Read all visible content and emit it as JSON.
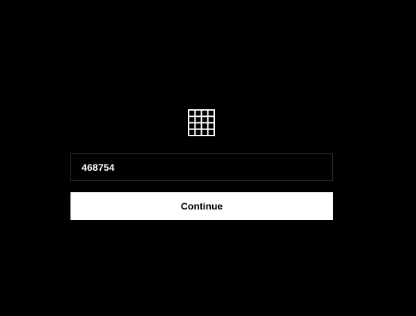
{
  "logo": {
    "icon": "grid-icon",
    "color": "#ffffff"
  },
  "form": {
    "code_value": "468754",
    "continue_label": "Continue"
  },
  "colors": {
    "background": "#000000",
    "input_border": "#3a3a3a",
    "button_background": "#ffffff",
    "button_text": "#000000"
  }
}
